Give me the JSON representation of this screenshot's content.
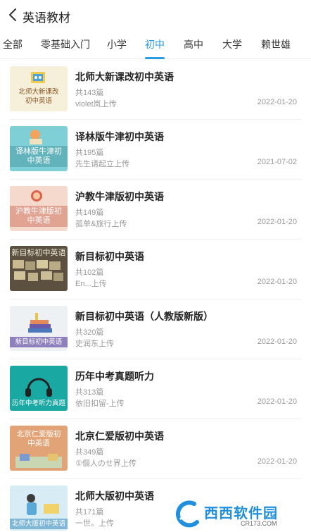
{
  "header": {
    "title": "英语教材"
  },
  "tabs": [
    {
      "label": "全部"
    },
    {
      "label": "零基础入门"
    },
    {
      "label": "小学"
    },
    {
      "label": "初中"
    },
    {
      "label": "高中"
    },
    {
      "label": "大学"
    },
    {
      "label": "赖世雄"
    }
  ],
  "active_tab": "初中",
  "colors": {
    "accent": "#2b9be6",
    "meta_text": "#999999"
  },
  "books": [
    {
      "title": "北师大新课改初中英语",
      "count": "共143篇",
      "uploader": "violet岚上传",
      "date": "2022-01-20",
      "cover_label": "北师大新课改初中英语"
    },
    {
      "title": "译林版牛津初中英语",
      "count": "共195篇",
      "uploader": "先生请起立上传",
      "date": "2021-07-02",
      "cover_label": "译林版牛津初中英语"
    },
    {
      "title": "沪教牛津版初中英语",
      "count": "共149篇",
      "uploader": "孤单&旅行上传",
      "date": "2022-01-20",
      "cover_label": "沪教牛津版初中英语"
    },
    {
      "title": "新目标初中英语",
      "count": "共102篇",
      "uploader": "En...上传",
      "date": "2022-01-20",
      "cover_label": "新目标初中英语"
    },
    {
      "title": "新目标初中英语（人教版新版）",
      "count": "共320篇",
      "uploader": "史润东上传",
      "date": "2022-01-20",
      "cover_label": "新目标初中英语"
    },
    {
      "title": "历年中考真题听力",
      "count": "共313篇",
      "uploader": "依旧扣留-上传",
      "date": "2022-01-20",
      "cover_label": "历年中考听力真题"
    },
    {
      "title": "北京仁爱版初中英语",
      "count": "共349篇",
      "uploader": "①個人のせ界上传",
      "date": "2022-01-20",
      "cover_label": "北京仁爱版初中英语"
    },
    {
      "title": "北师大版初中英语",
      "count": "共171篇",
      "uploader": "一世。上传",
      "date": "",
      "cover_label": "北师大版初中英语"
    }
  ],
  "watermark": {
    "text": "西西软件园",
    "url": "CR173.COM"
  }
}
